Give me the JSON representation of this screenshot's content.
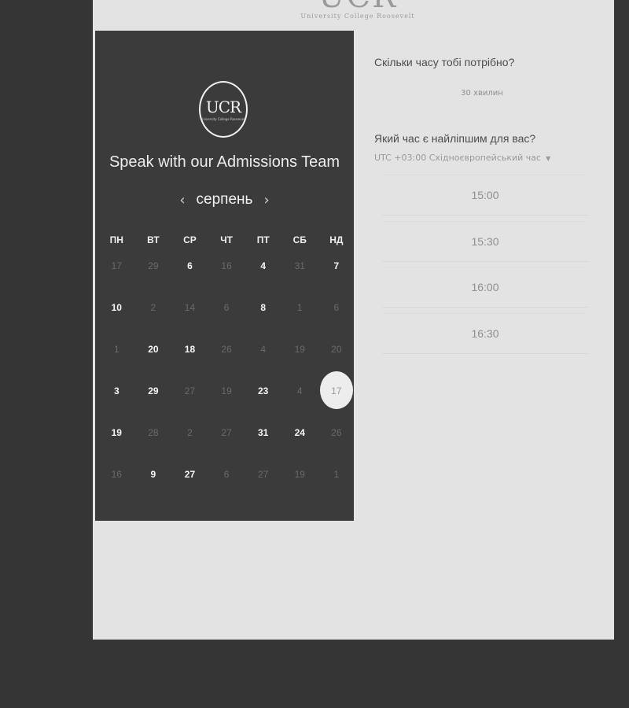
{
  "header": {
    "logo_text": "UCR",
    "logo_subtitle": "University College Roosevelt"
  },
  "calendar": {
    "logo_text": "UCR",
    "logo_subtitle": "University College Roosevelt",
    "title": "Speak with our Admissions Team",
    "month": "серпень",
    "prev_icon": "chevron-left-icon",
    "next_icon": "chevron-right-icon",
    "weekdays": [
      "ПН",
      "ВТ",
      "СР",
      "ЧТ",
      "ПТ",
      "СБ",
      "НД"
    ],
    "days": [
      {
        "n": "17",
        "s": "off"
      },
      {
        "n": "29",
        "s": "off"
      },
      {
        "n": "6",
        "s": "avail"
      },
      {
        "n": "16",
        "s": "off"
      },
      {
        "n": "4",
        "s": "avail"
      },
      {
        "n": "31",
        "s": "off"
      },
      {
        "n": "7",
        "s": "avail"
      },
      {
        "n": "10",
        "s": "avail"
      },
      {
        "n": "2",
        "s": "off"
      },
      {
        "n": "14",
        "s": "off"
      },
      {
        "n": "6",
        "s": "off"
      },
      {
        "n": "8",
        "s": "avail"
      },
      {
        "n": "1",
        "s": "off"
      },
      {
        "n": "6",
        "s": "off"
      },
      {
        "n": "1",
        "s": "off"
      },
      {
        "n": "20",
        "s": "avail"
      },
      {
        "n": "18",
        "s": "avail"
      },
      {
        "n": "26",
        "s": "off"
      },
      {
        "n": "4",
        "s": "off"
      },
      {
        "n": "19",
        "s": "off"
      },
      {
        "n": "20",
        "s": "off"
      },
      {
        "n": "3",
        "s": "avail"
      },
      {
        "n": "29",
        "s": "avail"
      },
      {
        "n": "27",
        "s": "off"
      },
      {
        "n": "19",
        "s": "off"
      },
      {
        "n": "23",
        "s": "avail"
      },
      {
        "n": "4",
        "s": "off"
      },
      {
        "n": "17",
        "s": "sel"
      },
      {
        "n": "19",
        "s": "avail"
      },
      {
        "n": "28",
        "s": "off"
      },
      {
        "n": "2",
        "s": "off"
      },
      {
        "n": "27",
        "s": "off"
      },
      {
        "n": "31",
        "s": "avail"
      },
      {
        "n": "24",
        "s": "avail"
      },
      {
        "n": "26",
        "s": "off"
      },
      {
        "n": "16",
        "s": "off"
      },
      {
        "n": "9",
        "s": "avail"
      },
      {
        "n": "27",
        "s": "avail"
      },
      {
        "n": "6",
        "s": "off"
      },
      {
        "n": "27",
        "s": "off"
      },
      {
        "n": "19",
        "s": "off"
      },
      {
        "n": "1",
        "s": "off"
      }
    ]
  },
  "booking": {
    "duration_question": "Скільки часу тобі потрібно?",
    "duration_value": "30 хвилин",
    "time_question": "Який час є найліпшим для вас?",
    "timezone": "UTC +03:00 Східноєвропейський час",
    "timezone_caret_icon": "caret-down-icon",
    "slots": [
      "15:00",
      "15:30",
      "16:00",
      "16:30"
    ]
  }
}
